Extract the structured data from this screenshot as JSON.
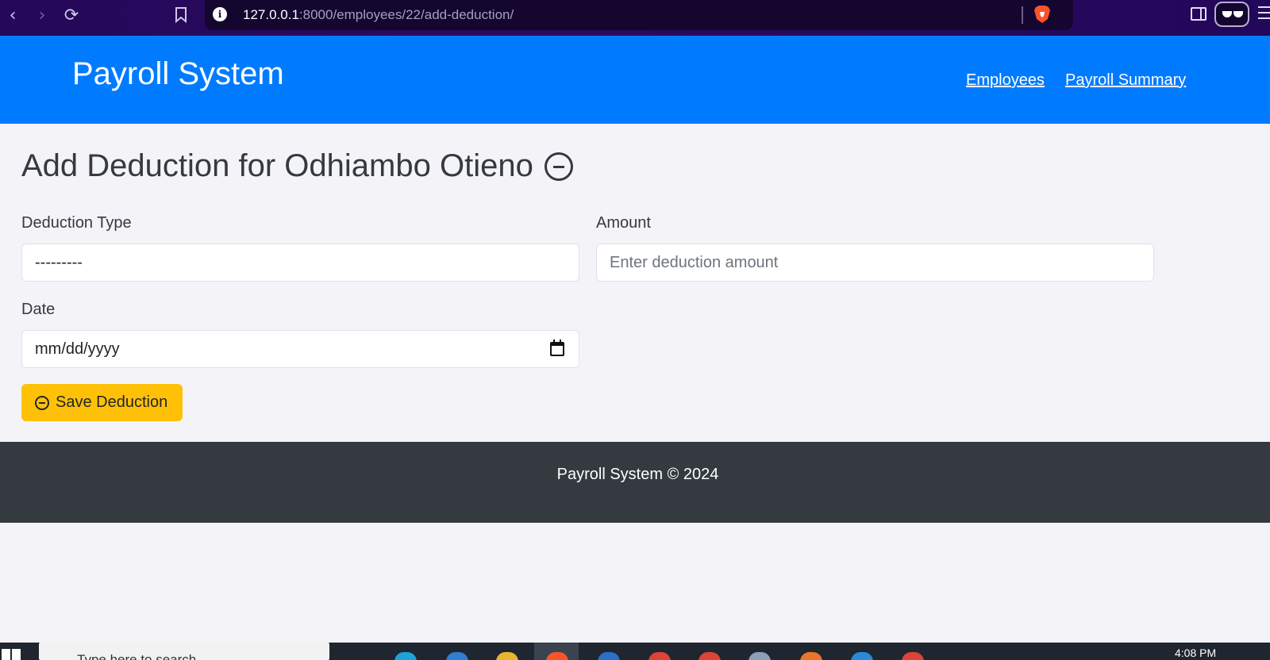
{
  "browser": {
    "url_host": "127.0.0.1",
    "url_path": ":8000/employees/22/add-deduction/"
  },
  "header": {
    "brand": "Payroll System",
    "nav": [
      {
        "label": "Employees"
      },
      {
        "label": "Payroll Summary"
      }
    ]
  },
  "main": {
    "title": "Add Deduction for Odhiambo Otieno",
    "form": {
      "deduction_type": {
        "label": "Deduction Type",
        "value": "---------"
      },
      "amount": {
        "label": "Amount",
        "placeholder": "Enter deduction amount"
      },
      "date": {
        "label": "Date",
        "placeholder": "mm/dd/yyyy"
      },
      "submit_label": "Save Deduction"
    }
  },
  "footer": {
    "text": "Payroll System © 2024"
  },
  "taskbar": {
    "search_text": "Type here to search",
    "time": "4:08 PM"
  },
  "colors": {
    "header_bg": "#007bff",
    "button_bg": "#ffc107",
    "footer_bg": "#343a40"
  }
}
